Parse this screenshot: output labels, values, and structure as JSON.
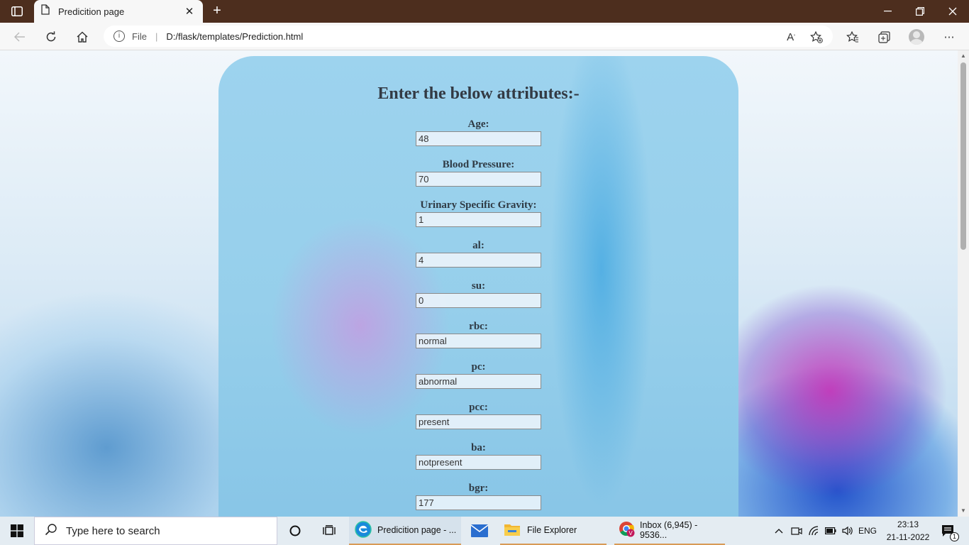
{
  "browser": {
    "tab_title": "Predicition page",
    "address_protocol": "File",
    "address_url": "D:/flask/templates/Prediction.html"
  },
  "page": {
    "heading": "Enter the below attributes:-",
    "fields": [
      {
        "label": "Age:",
        "value": "48"
      },
      {
        "label": "Blood Pressure:",
        "value": "70"
      },
      {
        "label": "Urinary Specific Gravity:",
        "value": "1"
      },
      {
        "label": "al:",
        "value": "4"
      },
      {
        "label": "su:",
        "value": "0"
      },
      {
        "label": "rbc:",
        "value": "normal"
      },
      {
        "label": "pc:",
        "value": "abnormal"
      },
      {
        "label": "pcc:",
        "value": "present"
      },
      {
        "label": "ba:",
        "value": "notpresent"
      },
      {
        "label": "bgr:",
        "value": "177"
      }
    ]
  },
  "taskbar": {
    "search_placeholder": "Type here to search",
    "apps": [
      {
        "label": "Predicition page - ..."
      },
      {
        "label": "File Explorer"
      },
      {
        "label": "Inbox (6,945) - 9536..."
      }
    ],
    "language": "ENG",
    "time": "23:13",
    "date": "21-11-2022",
    "notification_count": "1"
  },
  "colors": {
    "tabstrip": "#4d2e1e",
    "panel": "#9dd3ee",
    "taskbar": "#e4ecf2"
  }
}
